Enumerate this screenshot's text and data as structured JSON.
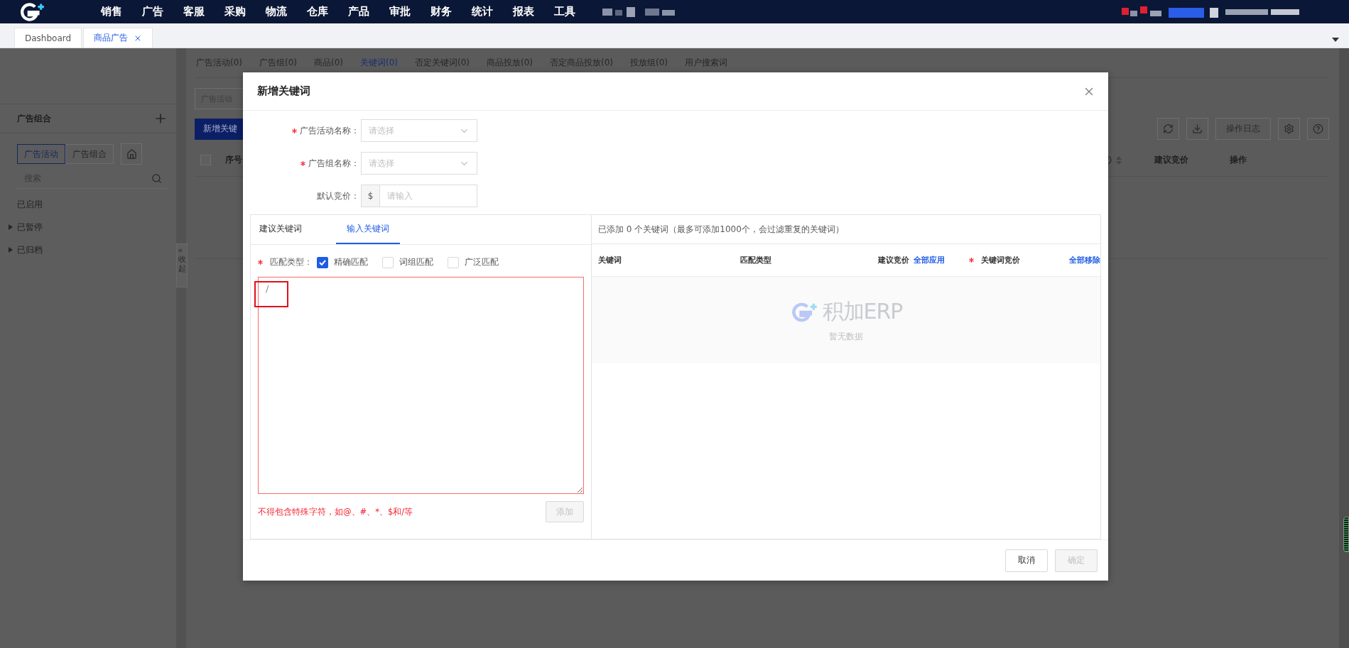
{
  "top_nav": {
    "menu": [
      "销售",
      "广告",
      "客服",
      "采购",
      "物流",
      "仓库",
      "产品",
      "审批",
      "财务",
      "统计",
      "报表",
      "工具"
    ]
  },
  "page_tabs": [
    {
      "label": "Dashboard",
      "selected": false,
      "closable": false
    },
    {
      "label": "商品广告",
      "selected": true,
      "closable": true
    }
  ],
  "sidebar": {
    "title": "广告组合",
    "segments": [
      {
        "label": "广告活动",
        "selected": true
      },
      {
        "label": "广告组合",
        "selected": false
      }
    ],
    "search": {
      "placeholder": "搜索"
    },
    "tree": [
      {
        "label": "已启用",
        "expandable": false
      },
      {
        "label": "已暂停",
        "expandable": true
      },
      {
        "label": "已归档",
        "expandable": true
      }
    ],
    "collapse": {
      "arrow": "«",
      "label": "收起"
    }
  },
  "content": {
    "tabs": [
      {
        "label": "广告活动(0)",
        "selected": false
      },
      {
        "label": "广告组(0)",
        "selected": false
      },
      {
        "label": "商品(0)",
        "selected": false
      },
      {
        "label": "关键词(0)",
        "selected": true
      },
      {
        "label": "否定关键词(0)",
        "selected": false
      },
      {
        "label": "商品投放(0)",
        "selected": false
      },
      {
        "label": "否定商品投放(0)",
        "selected": false
      },
      {
        "label": "投放组(0)",
        "selected": false
      },
      {
        "label": "用户搜索词",
        "selected": false
      }
    ],
    "select_all": {
      "checked": false
    },
    "filter": {
      "placeholder": "广告活动"
    },
    "add_button": "新增关键",
    "log_button": "操作日志",
    "columns_left": [
      "序号"
    ],
    "columns_right": [
      "建议竞价",
      "操作"
    ]
  },
  "modal": {
    "title": "新增关键词",
    "fields": [
      {
        "kind": "select",
        "label": "广告活动名称：",
        "required": true,
        "placeholder": "请选择"
      },
      {
        "kind": "select",
        "label": "广告组名称：",
        "required": true,
        "placeholder": "请选择"
      },
      {
        "kind": "currency",
        "label": "默认竞价：",
        "required": false,
        "prefix": "$",
        "placeholder": "请输入"
      }
    ],
    "keyword_tabs": [
      {
        "label": "建议关键词",
        "selected": false
      },
      {
        "label": "输入关键词",
        "selected": true
      }
    ],
    "match_type": {
      "label": "匹配类型：",
      "required": true,
      "options": [
        {
          "label": "精确匹配",
          "checked": true
        },
        {
          "label": "词组匹配",
          "checked": false
        },
        {
          "label": "广泛匹配",
          "checked": false
        }
      ]
    },
    "keywords_input": {
      "value": "/",
      "invalid": true,
      "highlighted": true
    },
    "error": "不得包含特殊字符，如@、#、*、$和/等",
    "add_button": {
      "label": "添加",
      "disabled": true
    },
    "added_summary": "已添加 0 个关键词（最多可添加1000个，会过滤重复的关键词）",
    "columns": [
      {
        "label": "关键词",
        "required": false
      },
      {
        "label": "匹配类型",
        "required": false
      },
      {
        "label": "建议竞价",
        "required": false,
        "action": "全部应用"
      },
      {
        "label": "关键词竞价",
        "required": true
      }
    ],
    "remove_all": "全部移除",
    "empty": {
      "logo": "积加ERP",
      "text": "暂无数据"
    },
    "buttons": [
      {
        "label": "取消",
        "disabled": false
      },
      {
        "label": "确定",
        "disabled": true
      }
    ]
  }
}
